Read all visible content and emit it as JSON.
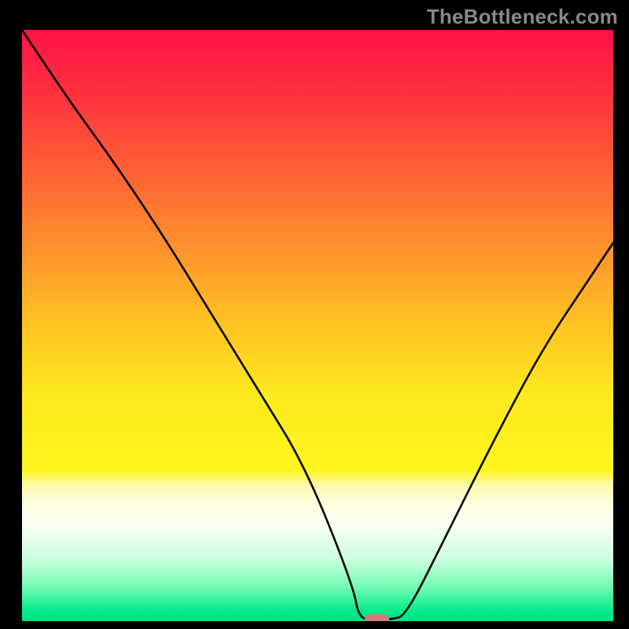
{
  "watermark": "TheBottleneck.com",
  "chart_data": {
    "type": "line",
    "title": "",
    "xlabel": "",
    "ylabel": "",
    "xlim": [
      0,
      100
    ],
    "ylim": [
      0,
      100
    ],
    "grid": false,
    "legend": false,
    "series": [
      {
        "name": "bottleneck-curve",
        "x": [
          0,
          8,
          16,
          24,
          32,
          40,
          48,
          56,
          57,
          60,
          62.5,
          65,
          72,
          80,
          88,
          96,
          100
        ],
        "y": [
          100,
          88,
          77,
          65,
          52,
          39,
          26,
          6,
          0.3,
          0.3,
          0.3,
          1,
          15,
          31,
          46,
          58,
          64
        ]
      }
    ],
    "marker": {
      "name": "optimal-point",
      "x": 60,
      "y": 0.3,
      "color": "#d47a78",
      "rx": 16,
      "ry": 7
    },
    "gradient_stops": [
      {
        "offset": 0,
        "color": "#ff1249"
      },
      {
        "offset": 0.1,
        "color": "#ff2e3f"
      },
      {
        "offset": 0.22,
        "color": "#ff5a36"
      },
      {
        "offset": 0.35,
        "color": "#ff8a2d"
      },
      {
        "offset": 0.5,
        "color": "#ffc423"
      },
      {
        "offset": 0.62,
        "color": "#fee91e"
      },
      {
        "offset": 0.745,
        "color": "#fef61e"
      },
      {
        "offset": 0.77,
        "color": "#fefbac"
      },
      {
        "offset": 0.8,
        "color": "#fefee0"
      },
      {
        "offset": 0.83,
        "color": "#fbfef0"
      },
      {
        "offset": 0.86,
        "color": "#eafeed"
      },
      {
        "offset": 0.9,
        "color": "#c3feda"
      },
      {
        "offset": 0.94,
        "color": "#77fbb4"
      },
      {
        "offset": 0.985,
        "color": "#00e988"
      },
      {
        "offset": 1.0,
        "color": "#00e183"
      }
    ]
  }
}
